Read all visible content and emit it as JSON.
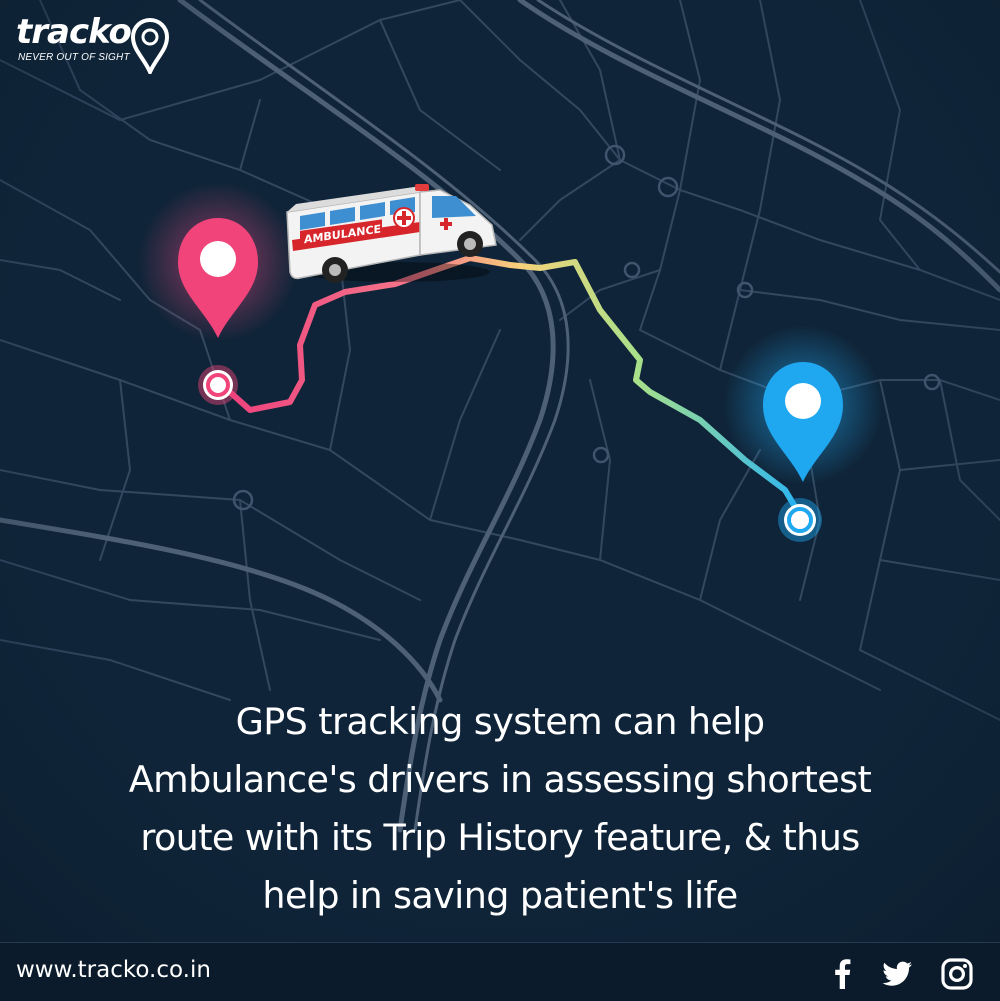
{
  "brand": {
    "name": "tracko",
    "tagline": "NEVER OUT OF SIGHT"
  },
  "vehicle": {
    "label": "AMBULANCE"
  },
  "headline": {
    "lines": [
      "GPS tracking system can help",
      "Ambulance's drivers in assessing shortest",
      "route with its Trip History feature, & thus",
      "help in saving patient's life"
    ]
  },
  "footer": {
    "url": "www.tracko.co.in"
  },
  "icons": {
    "facebook": "facebook-icon",
    "twitter": "twitter-icon",
    "instagram": "instagram-icon",
    "start_pin": "location-pin-icon",
    "end_pin": "location-pin-icon",
    "vehicle": "ambulance-icon"
  },
  "colors": {
    "background": "#0f2438",
    "road": "#3a4f66",
    "start_marker": "#f0447a",
    "end_marker": "#1fa7f0",
    "route_start": "#ee3f7d",
    "route_mid": "#f5c46a",
    "route_end": "#2db6f2",
    "text": "#ffffff"
  }
}
